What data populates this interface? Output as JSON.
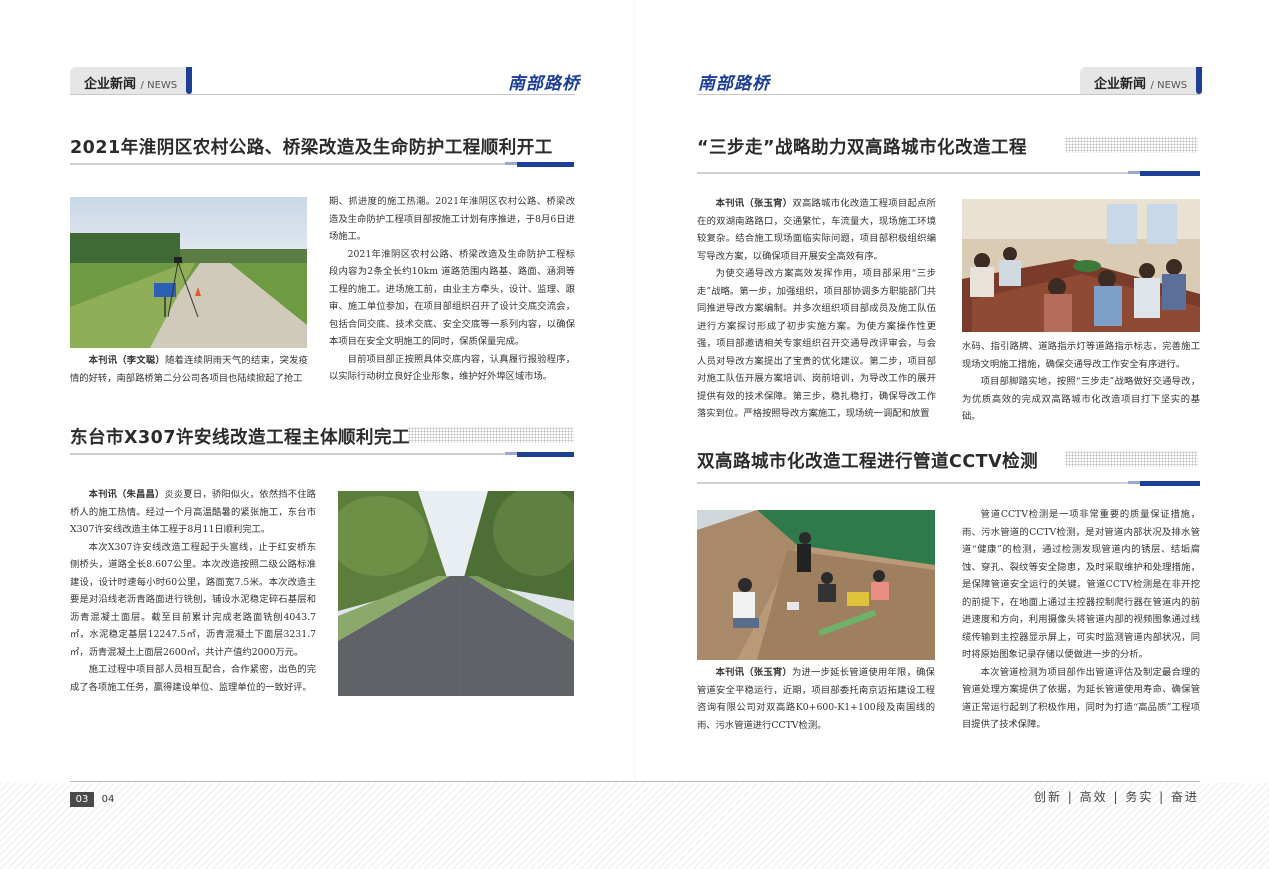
{
  "header": {
    "section_label": "企业新闻",
    "section_sub": "/ NEWS",
    "brand": "南部路桥"
  },
  "articles": {
    "a1": {
      "title": "2021年淮阴区农村公路、桥梁改造及生命防护工程顺利开工",
      "lead_byline": "本刊讯（李文聪）",
      "lead_text": "随着连续阴雨天气的结束，突发疫情的好转，南部路桥第二分公司各项目也陆续掀起了抢工",
      "col_p1": "期、抓进度的施工热潮。2021年淮阴区农村公路、桥梁改造及生命防护工程项目部按施工计划有序推进，于8月6日进场施工。",
      "col_p2": "2021年淮阴区农村公路、桥梁改造及生命防护工程标段内容为2条全长约10km 道路范围内路基、路面、涵洞等工程的施工。进场施工前，由业主方牵头，设计、监理、跟审、施工单位参加，在项目部组织召开了设计交底交流会，包括合同交底、技术交底、安全交底等一系列内容，以确保本项目在安全文明施工的同时，保质保量完成。",
      "col_p3": "目前项目部正按照具体交底内容，认真履行报验程序，以实际行动树立良好企业形象，维护好外埠区域市场。"
    },
    "a2": {
      "title": "东台市X307许安线改造工程主体顺利完工",
      "p1_byline": "本刊讯（朱昌昌）",
      "p1": "炎炎夏日，骄阳似火，依然挡不住路桥人的施工热情。经过一个月高温酷暑的紧张施工，东台市X307许安线改造主体工程于8月11日顺利完工。",
      "p2": "本次X307许安线改造工程起于头富线，止于红安桥东侧桥头，道路全长8.607公里。本次改造按照二级公路标准建设，设计时速每小时60公里，路面宽7.5米。本次改造主要是对沿线老沥青路面进行铣刨，铺设水泥稳定碎石基层和沥青混凝土面层。截至目前累计完成老路面铣刨4043.7㎡，水泥稳定基层12247.5㎡，沥青混凝土下面层3231.7㎡，沥青混凝土上面层2600㎡，共计产值约2000万元。",
      "p3": "施工过程中项目部人员相互配合，合作紧密，出色的完成了各项施工任务，赢得建设单位、监理单位的一致好评。"
    },
    "a3": {
      "title": "“三步走”战略助力双高路城市化改造工程",
      "p1_byline": "本刊讯（张玉宵）",
      "p1": "双高路城市化改造工程项目起点所在的双湖南路路口，交通繁忙，车流量大，现场施工环境较复杂。结合施工现场面临实际问题，项目部积极组织编写导改方案，以确保项目开展安全高效有序。",
      "p2": "为使交通导改方案高效发挥作用，项目部采用“三步走”战略。第一步，加强组织，项目部协调多方职能部门共同推进导改方案编制。并多次组织项目部成员及施工队伍进行方案探讨形成了初步实施方案。为使方案操作性更强，项目部邀请相关专家组织召开交通导改评审会，与会人员对导改方案提出了宝贵的优化建议。第二步，项目部对施工队伍开展方案培训、岗前培训，为导改工作的展开提供有效的技术保障。第三步，稳扎稳打，确保导改工作落实到位。严格按照导改方案施工，现场统一调配和放置",
      "col_p1": "水码、指引路牌、道路指示灯等道路指示标志，完善施工现场文明施工措施，确保交通导改工作安全有序进行。",
      "col_p2": "项目部脚踏实地，按照“三步走”战略做好交通导改，为优质高效的完成双高路城市化改造项目打下坚实的基础。"
    },
    "a4": {
      "title": "双高路城市化改造工程进行管道CCTV检测",
      "lead_byline": "本刊讯（张玉宵）",
      "lead_text": "为进一步延长管道使用年限，确保管道安全平稳运行，近期，项目部委托南京迈拓建设工程咨询有限公司对双高路K0+600-K1+100段及南国线的雨、污水管道进行CCTV检测。",
      "col_p1": "管道CCTV检测是一项非常重要的质量保证措施，雨、污水管道的CCTV检测，是对管道内部状况及排水管道“健康”的检测，通过检测发现管道内的锈层、结垢腐蚀、穿孔、裂纹等安全隐患，及时采取维护和处理措施，是保障管道安全运行的关键。管道CCTV检测是在非开挖的前提下，在地面上通过主控器控制爬行器在管道内的前进速度和方向，利用摄像头将管道内部的视频图象通过线缆传输到主控器显示屏上，可实时监测管道内部状况，同时将原始图象记录存储以便做进一步的分析。",
      "col_p2": "本次管道检测为项目部作出管道评估及制定最合理的管道处理方案提供了依据，为延长管道使用寿命、确保管道正常运行起到了积极作用，同时为打造“高品质”工程项目提供了技术保障。"
    }
  },
  "footer": {
    "page_current": "03",
    "page_next": "04",
    "slogan": "创新 | 高效 | 务实 | 奋进"
  },
  "colors": {
    "brand_blue": "#1d3f95",
    "rule_gray": "#cfcfcf",
    "tab_gray": "#e6e6e6"
  },
  "icons": {
    "photo1": "rural-road-construction-photo",
    "photo2": "asphalt-road-photo",
    "photo3": "meeting-room-photo",
    "photo4": "cctv-pipeline-inspection-photo"
  }
}
